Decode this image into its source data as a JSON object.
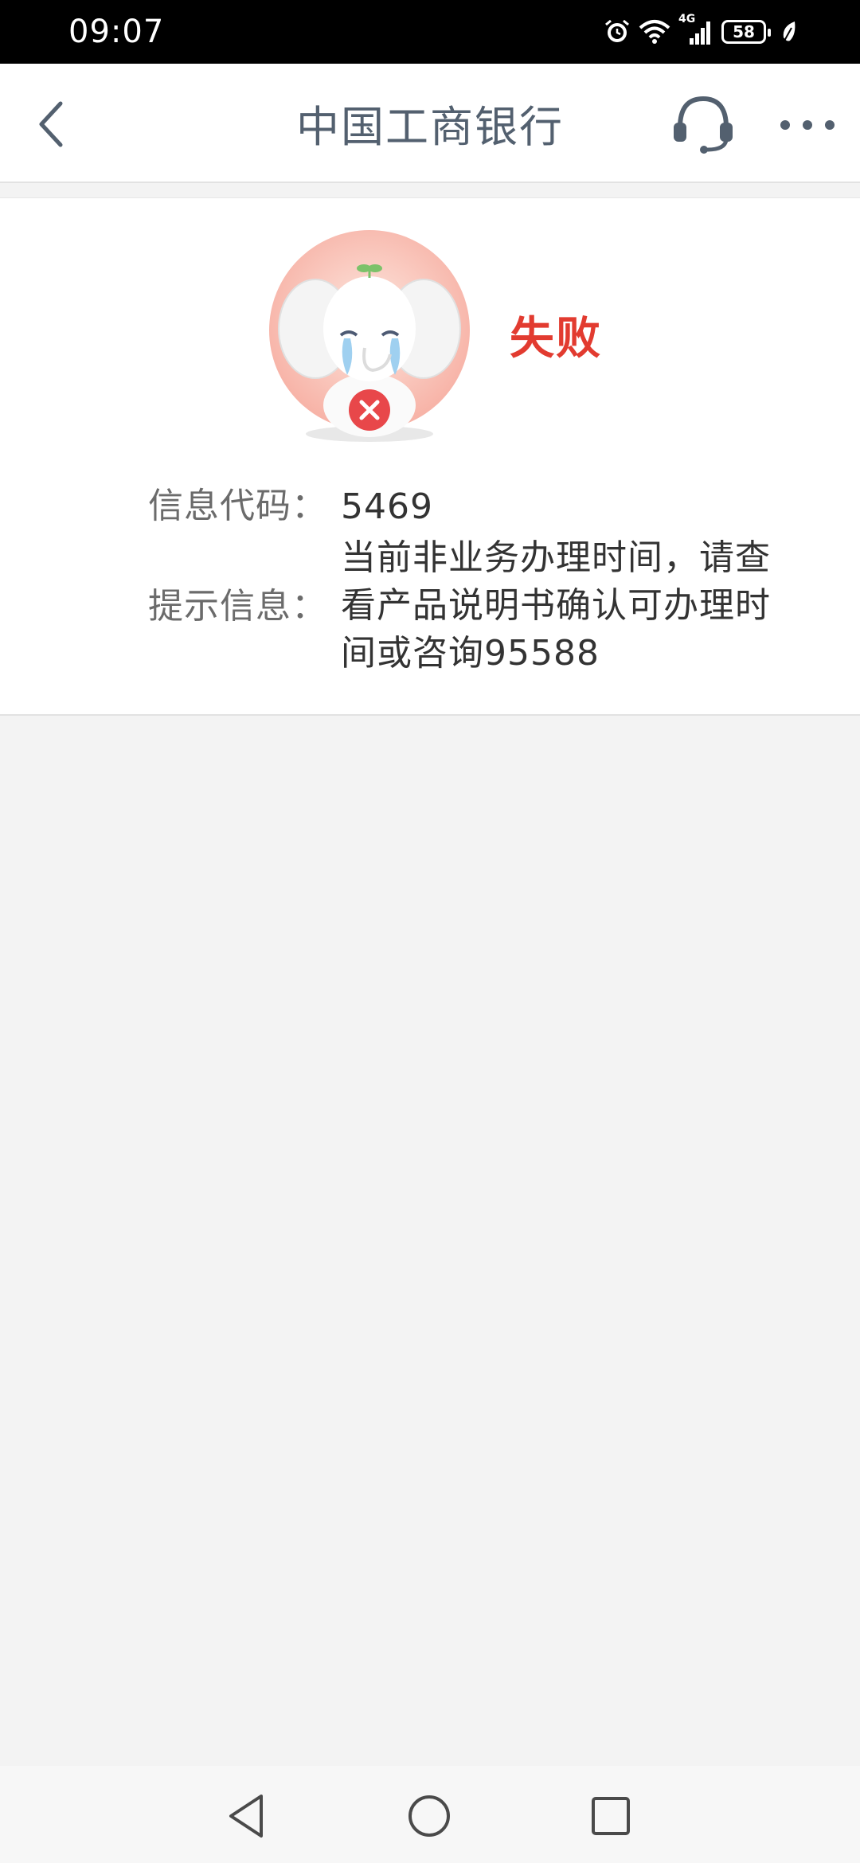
{
  "status_bar": {
    "time": "09:07",
    "network": "4G",
    "battery": "58",
    "icons": [
      "alarm-icon",
      "wifi-icon",
      "cellular-signal-icon",
      "battery-icon",
      "leaf-icon"
    ]
  },
  "header": {
    "title": "中国工商银行",
    "icons": [
      "back-arrow-icon",
      "headset-icon",
      "more-icon"
    ]
  },
  "result": {
    "status": "失败",
    "status_color": "#e23b30",
    "code_label": "信息代码：",
    "code_value": "5469",
    "message_label": "提示信息：",
    "message_value": "当前非业务办理时间，请查看产品说明书确认可办理时间或咨询95588"
  },
  "nav_bar": {
    "icons": [
      "triangle-back-icon",
      "circle-home-icon",
      "square-recents-icon"
    ]
  }
}
